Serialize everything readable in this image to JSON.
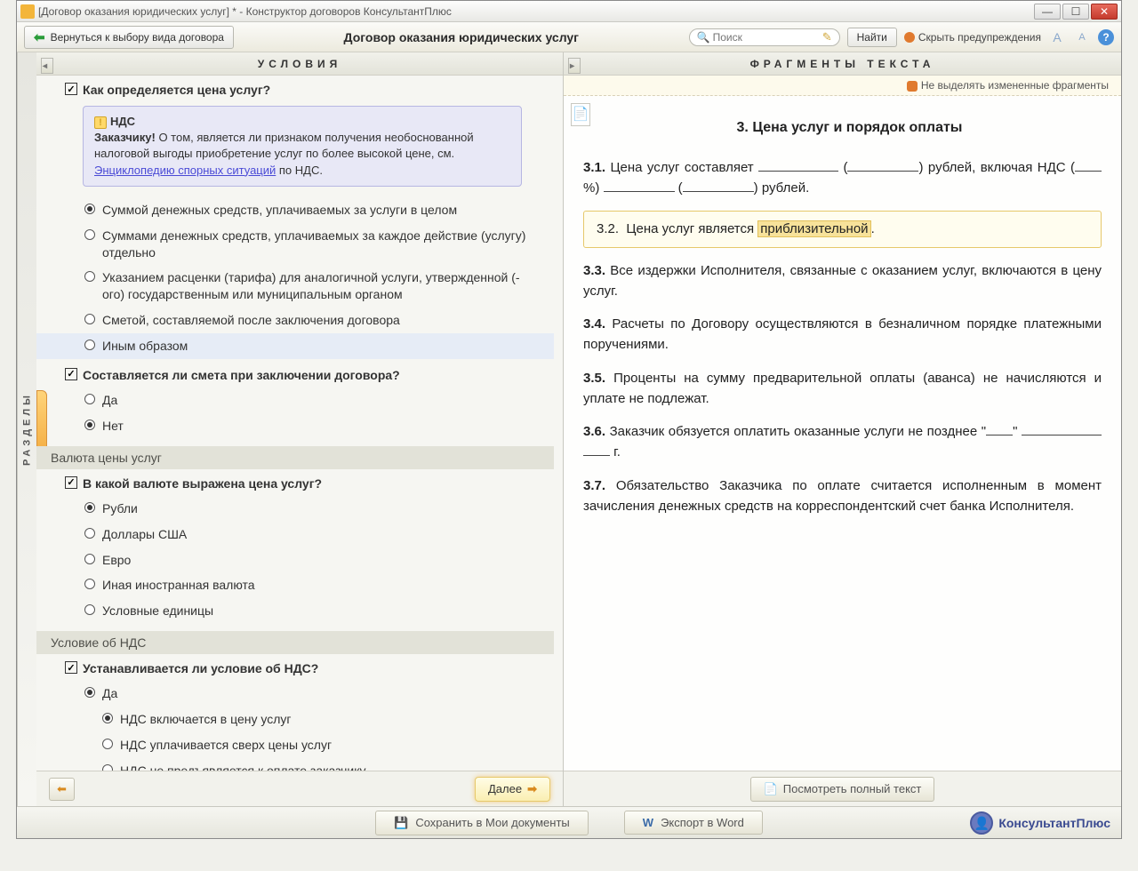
{
  "window_title": "[Договор оказания юридических услуг] * - Конструктор договоров КонсультантПлюс",
  "toolbar": {
    "back": "Вернуться к выбору вида договора",
    "title": "Договор оказания юридических услуг",
    "search_placeholder": "Поиск",
    "find": "Найти",
    "hide_warnings": "Скрыть предупреждения"
  },
  "side_tab": "РАЗДЕЛЫ",
  "left": {
    "header": "УСЛОВИЯ",
    "q1": "Как определяется цена услуг?",
    "note_title": "НДС",
    "note_lead": "Заказчику!",
    "note_text_a": " О том, является ли признаком получения необоснованной налоговой выгоды приобретение услуг по более высокой цене, см. ",
    "note_link": "Энциклопедию спорных ситуаций",
    "note_text_b": " по НДС.",
    "opt1_1": "Суммой денежных средств, уплачиваемых за услуги в целом",
    "opt1_2": "Суммами денежных средств, уплачиваемых за каждое действие (услугу) отдельно",
    "opt1_3": "Указанием расценки (тарифа) для аналогичной услуги, утвержденной (-ого) государственным или муниципальным органом",
    "opt1_4": "Сметой, составляемой после заключения договора",
    "opt1_5": "Иным образом",
    "q2": "Составляется ли смета при заключении договора?",
    "opt2_1": "Да",
    "opt2_2": "Нет",
    "group2": "Валюта цены услуг",
    "q3": "В какой валюте выражена цена услуг?",
    "opt3_1": "Рубли",
    "opt3_2": "Доллары США",
    "opt3_3": "Евро",
    "opt3_4": "Иная иностранная валюта",
    "opt3_5": "Условные единицы",
    "group3": "Условие об НДС",
    "q4": "Устанавливается ли условие об НДС?",
    "opt4_1": "Да",
    "opt4_1_1": "НДС включается в цену услуг",
    "opt4_1_2": "НДС уплачивается сверх цены услуг",
    "opt4_1_3": "НДС не предъявляется к оплате заказчику",
    "next": "Далее"
  },
  "right": {
    "header": "ФРАГМЕНТЫ ТЕКСТА",
    "warn_strip": "Не выделять измененные фрагменты",
    "section_title": "3.  Цена услуг и порядок оплаты",
    "c31_num": "3.1.",
    "c31_a": "Цена услуг составляет ",
    "c31_b": " (",
    "c31_c": ") рублей, включая НДС (",
    "c31_d": "%) ",
    "c31_e": " (",
    "c31_f": ") рублей.",
    "c32_num": "3.2.",
    "c32_a": "Цена услуг является ",
    "c32_hl": "приблизительной",
    "c32_b": ".",
    "c33_num": "3.3.",
    "c33": "Все издержки Исполнителя, связанные с оказанием услуг, включаются в цену услуг.",
    "c34_num": "3.4.",
    "c34": "Расчеты по Договору осуществляются в безналичном порядке платежными поручениями.",
    "c35_num": "3.5.",
    "c35": "Проценты на сумму предварительной оплаты (аванса) не начисляются и уплате не подлежат.",
    "c36_num": "3.6.",
    "c36_a": "Заказчик обязуется оплатить оказанные услуги не позднее \"",
    "c36_b": "\" ",
    "c36_c": " ",
    "c36_d": " г.",
    "c37_num": "3.7.",
    "c37": "Обязательство Заказчика по оплате считается исполненным в момент зачисления денежных средств на корреспондентский счет банка Исполнителя.",
    "view_full": "Посмотреть полный текст"
  },
  "bottom": {
    "save": "Сохранить в Мои документы",
    "export": "Экспорт в Word",
    "brand": "КонсультантПлюс"
  }
}
